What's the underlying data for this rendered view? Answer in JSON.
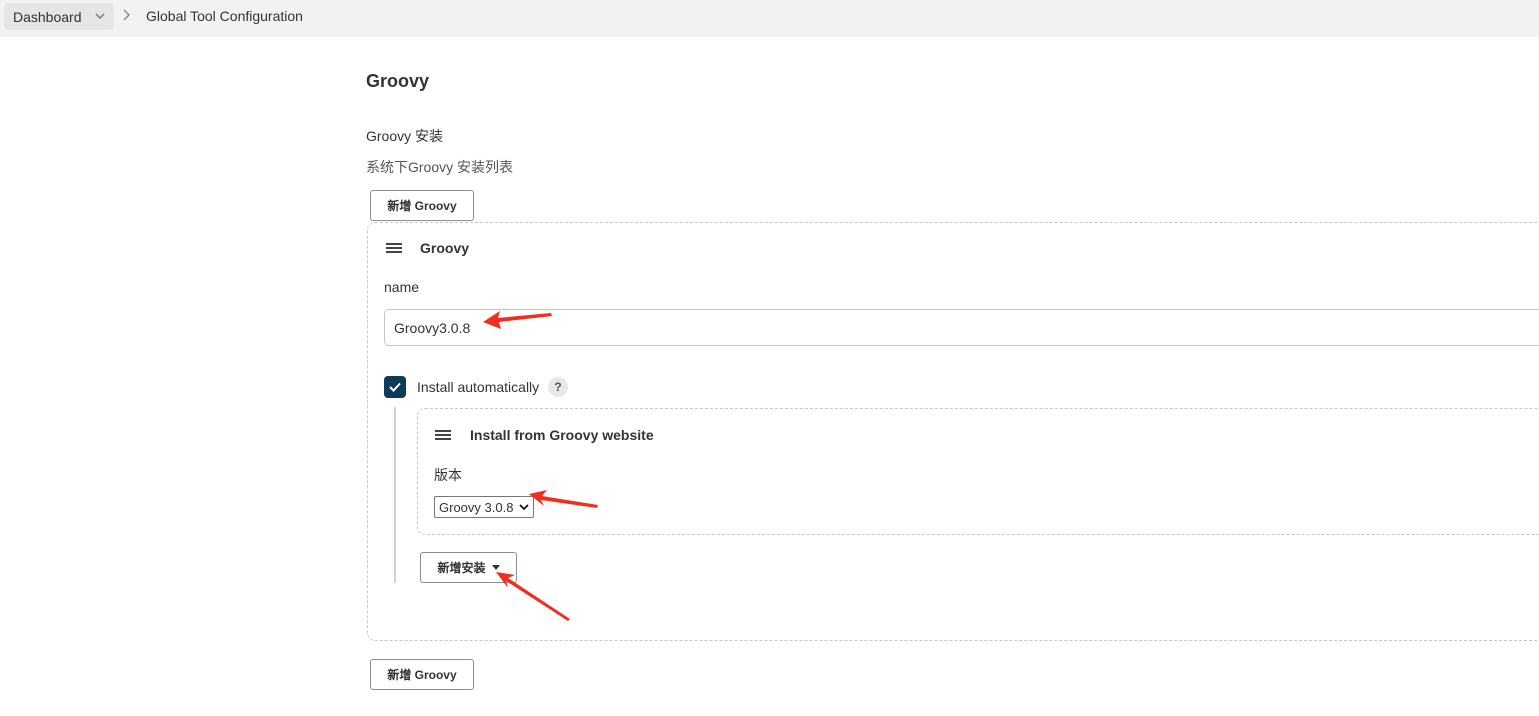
{
  "breadcrumb": {
    "items": [
      {
        "label": "Dashboard"
      },
      {
        "label": "Global Tool Configuration"
      }
    ]
  },
  "section": {
    "title": "Groovy",
    "installations_label": "Groovy 安装",
    "installations_desc": "系统下Groovy 安装列表",
    "add_button": "新增 Groovy"
  },
  "installation": {
    "title": "Groovy",
    "name_label": "name",
    "name_value": "Groovy3.0.8",
    "install_auto_label": "Install automatically",
    "install_auto_checked": true,
    "help_glyph": "?",
    "installer": {
      "title": "Install from Groovy website",
      "version_label": "版本",
      "version_selected": "Groovy 3.0.8"
    },
    "add_installer_button": "新增安装"
  },
  "colors": {
    "checkbox": "#0f3b5a",
    "annotation_arrow": "#f02d1e",
    "topbar": "#f2f2f2"
  },
  "icons": [
    "chevron-down-icon",
    "chevron-right-icon",
    "drag-handle-icon",
    "checkmark-icon",
    "help-icon",
    "caret-down-icon",
    "annotation-arrow-icon"
  ]
}
